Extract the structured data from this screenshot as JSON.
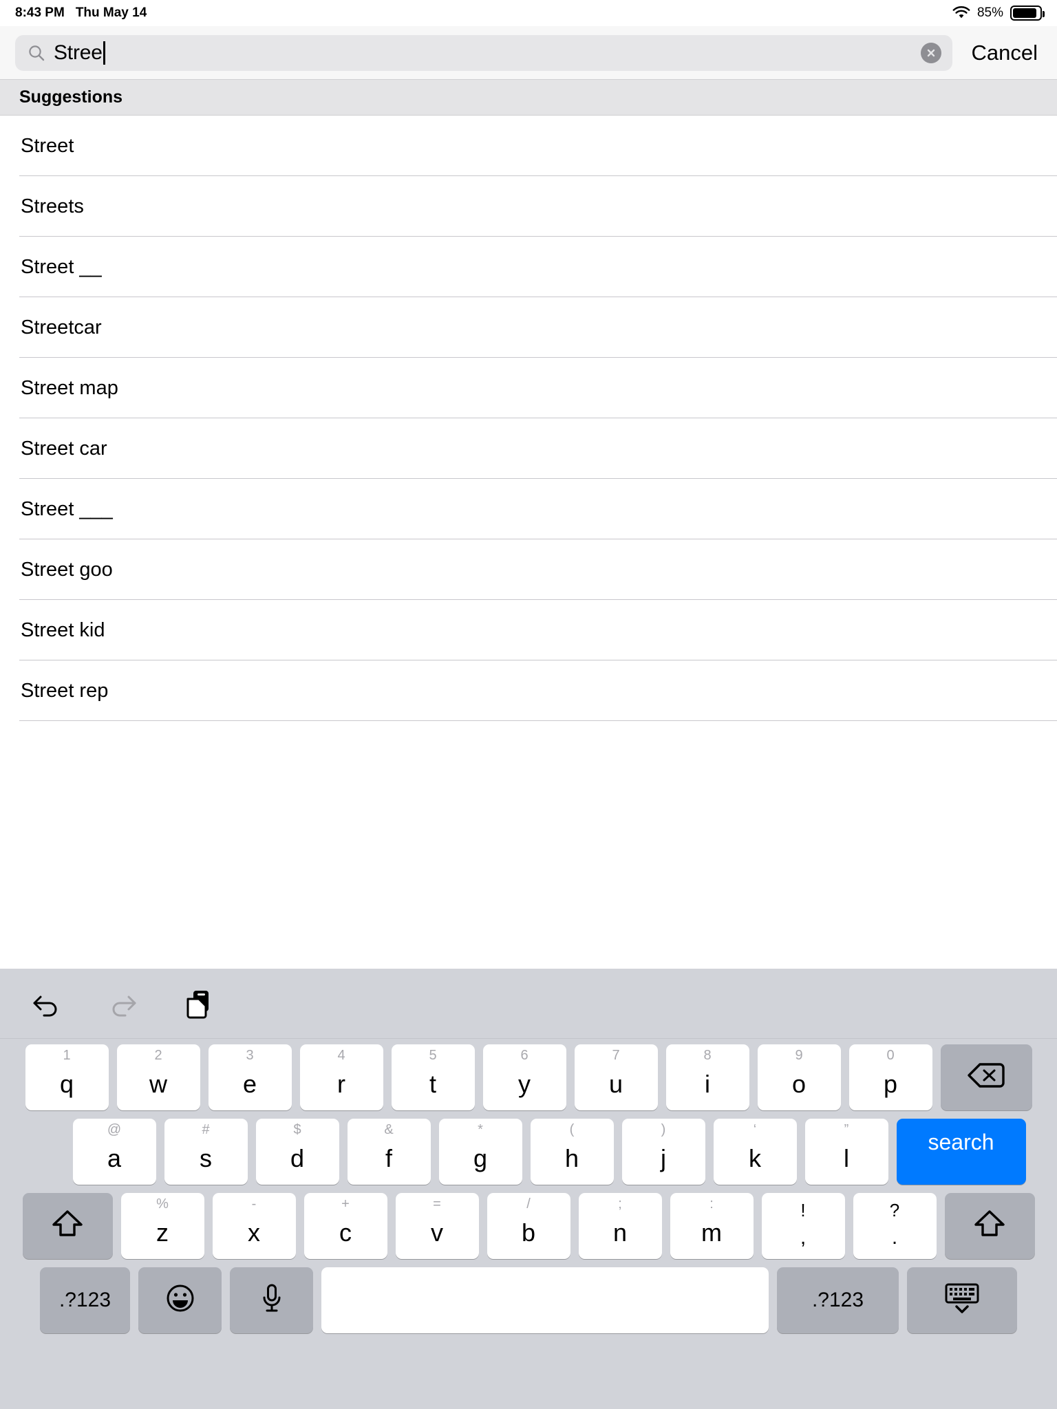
{
  "status_bar": {
    "time": "8:43 PM",
    "date": "Thu May 14",
    "wifi_icon": "wifi-icon",
    "battery_percent": "85%",
    "battery_level": 85
  },
  "search": {
    "value": "Stree",
    "search_icon": "search-icon",
    "clear_icon": "clear-icon",
    "cancel_label": "Cancel"
  },
  "suggestions": {
    "header": "Suggestions",
    "items": [
      {
        "label": "Street"
      },
      {
        "label": "Streets"
      },
      {
        "label": "Street __"
      },
      {
        "label": "Streetcar"
      },
      {
        "label": "Street map"
      },
      {
        "label": "Street car"
      },
      {
        "label": "Street ___"
      },
      {
        "label": "Street goo"
      },
      {
        "label": "Street kid"
      },
      {
        "label": "Street rep"
      }
    ]
  },
  "keyboard": {
    "toolbar": {
      "undo_icon": "undo-icon",
      "redo_icon": "redo-icon",
      "paste_icon": "paste-icon"
    },
    "row1": [
      {
        "sub": "1",
        "main": "q"
      },
      {
        "sub": "2",
        "main": "w"
      },
      {
        "sub": "3",
        "main": "e"
      },
      {
        "sub": "4",
        "main": "r"
      },
      {
        "sub": "5",
        "main": "t"
      },
      {
        "sub": "6",
        "main": "y"
      },
      {
        "sub": "7",
        "main": "u"
      },
      {
        "sub": "8",
        "main": "i"
      },
      {
        "sub": "9",
        "main": "o"
      },
      {
        "sub": "0",
        "main": "p"
      }
    ],
    "backspace_icon": "backspace-icon",
    "row2": [
      {
        "sub": "@",
        "main": "a"
      },
      {
        "sub": "#",
        "main": "s"
      },
      {
        "sub": "$",
        "main": "d"
      },
      {
        "sub": "&",
        "main": "f"
      },
      {
        "sub": "*",
        "main": "g"
      },
      {
        "sub": "(",
        "main": "h"
      },
      {
        "sub": ")",
        "main": "j"
      },
      {
        "sub": "‘",
        "main": "k"
      },
      {
        "sub": "”",
        "main": "l"
      }
    ],
    "search_key_label": "search",
    "shift_icon": "shift-icon",
    "row3": [
      {
        "sub": "%",
        "main": "z"
      },
      {
        "sub": "-",
        "main": "x"
      },
      {
        "sub": "+",
        "main": "c"
      },
      {
        "sub": "=",
        "main": "v"
      },
      {
        "sub": "/",
        "main": "b"
      },
      {
        "sub": ";",
        "main": "n"
      },
      {
        "sub": ":",
        "main": "m"
      },
      {
        "sub": "!",
        "main": ","
      },
      {
        "sub": "?",
        "main": "."
      }
    ],
    "shift_right_icon": "shift-icon",
    "row4": {
      "numeric_left_label": ".?123",
      "emoji_icon": "emoji-icon",
      "mic_icon": "microphone-icon",
      "space_label": "",
      "numeric_right_label": ".?123",
      "dismiss_icon": "dismiss-keyboard-icon"
    }
  },
  "colors": {
    "accent_blue": "#007aff",
    "keyboard_bg": "#d1d3d9",
    "key_dark": "#adb0b8",
    "section_header_bg": "#e4e4e6"
  }
}
